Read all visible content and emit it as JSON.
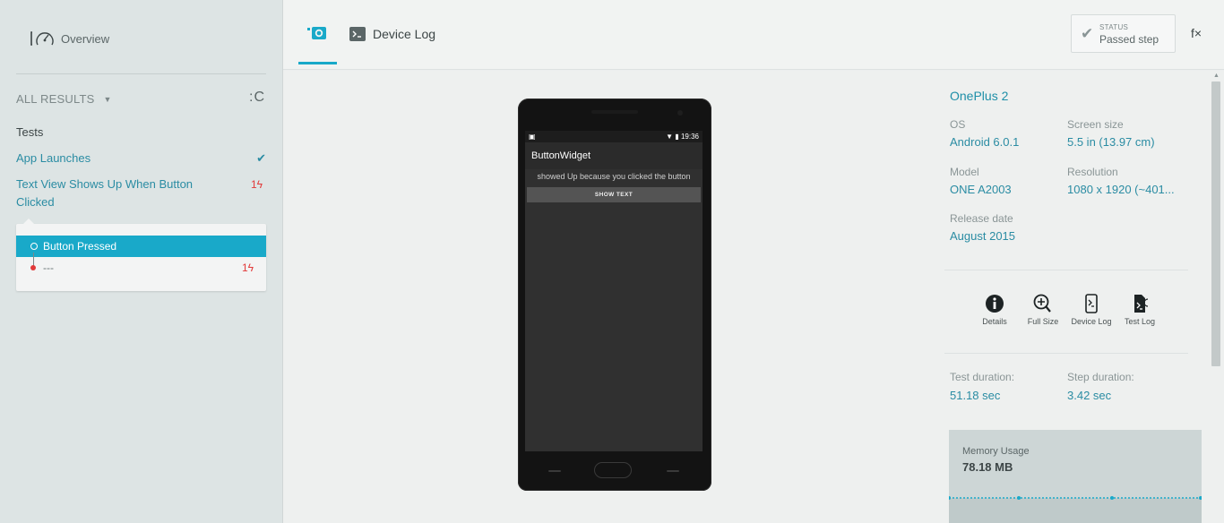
{
  "sidebar": {
    "overview_label": "Overview",
    "filter_label": "ALL RESULTS",
    "refresh_label": ":C",
    "tests_heading": "Tests",
    "tests": [
      {
        "name": "App Launches",
        "status": "passed"
      },
      {
        "name": "Text View Shows Up When Button Clicked",
        "failures": "1ϟ"
      }
    ],
    "steps": [
      {
        "name": "Button Pressed",
        "status": "active"
      },
      {
        "name": "---",
        "failures": "1ϟ"
      }
    ]
  },
  "tabs": {
    "device_log_label": "Device Log"
  },
  "status": {
    "title": "STATUS",
    "value": "Passed step"
  },
  "fx_label": "f×",
  "phone": {
    "time": "19:36",
    "app_title": "ButtonWidget",
    "message": "showed Up because you clicked the button",
    "button_label": "SHOW TEXT"
  },
  "device": {
    "name": "OnePlus 2",
    "os_label": "OS",
    "os": "Android 6.0.1",
    "screen_label": "Screen size",
    "screen": "5.5 in (13.97 cm)",
    "model_label": "Model",
    "model": "ONE A2003",
    "resolution_label": "Resolution",
    "resolution": "1080 x 1920 (~401...",
    "release_label": "Release date",
    "release": "August 2015"
  },
  "actions": [
    {
      "label": "Details",
      "icon": "info-icon"
    },
    {
      "label": "Full Size",
      "icon": "zoom-in-icon"
    },
    {
      "label": "Device Log",
      "icon": "phone-terminal-icon"
    },
    {
      "label": "Test Log",
      "icon": "file-terminal-icon"
    }
  ],
  "durations": {
    "test_label": "Test duration:",
    "test_value": "51.18 sec",
    "step_label": "Step duration:",
    "step_value": "3.42 sec"
  },
  "memory": {
    "label": "Memory Usage",
    "value": "78.18 MB"
  },
  "colors": {
    "accent": "#19a9c9",
    "link": "#2a8ca3",
    "fail": "#e23a3a",
    "sidebar_bg": "#dde4e4"
  }
}
